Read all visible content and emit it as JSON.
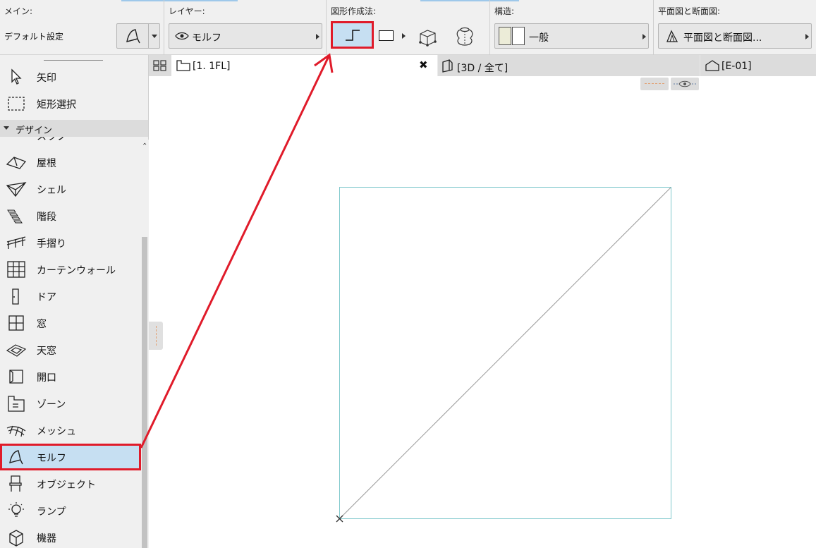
{
  "infobox": {
    "main": {
      "title": "メイン:",
      "default_label": "デフォルト設定"
    },
    "layer": {
      "title": "レイヤー:",
      "value": "モルフ"
    },
    "geometry": {
      "title": "図形作成法:"
    },
    "structure": {
      "title": "構造:",
      "value": "一般"
    },
    "plan_section": {
      "title": "平面図と断面図:",
      "value": "平面図と断面図..."
    }
  },
  "sidebar": {
    "top_items": [
      {
        "label": "矢印",
        "icon": "arrow-cursor-icon"
      },
      {
        "label": "矩形選択",
        "icon": "marquee-icon"
      }
    ],
    "section_header": "デザイン",
    "partial_item": "スラブ",
    "items": [
      {
        "label": "屋根",
        "icon": "roof-icon"
      },
      {
        "label": "シェル",
        "icon": "shell-icon"
      },
      {
        "label": "階段",
        "icon": "stair-icon"
      },
      {
        "label": "手摺り",
        "icon": "railing-icon"
      },
      {
        "label": "カーテンウォール",
        "icon": "curtain-wall-icon"
      },
      {
        "label": "ドア",
        "icon": "door-icon"
      },
      {
        "label": "窓",
        "icon": "window-icon"
      },
      {
        "label": "天窓",
        "icon": "skylight-icon"
      },
      {
        "label": "開口",
        "icon": "opening-icon"
      },
      {
        "label": "ゾーン",
        "icon": "zone-icon"
      },
      {
        "label": "メッシュ",
        "icon": "mesh-icon"
      },
      {
        "label": "モルフ",
        "icon": "morph-icon",
        "selected": true
      },
      {
        "label": "オブジェクト",
        "icon": "object-icon"
      },
      {
        "label": "ランプ",
        "icon": "lamp-icon"
      },
      {
        "label": "機器",
        "icon": "equipment-icon"
      }
    ]
  },
  "tabs": [
    {
      "label": "[1. 1FL]",
      "icon": "floor-plan-icon",
      "active": true
    },
    {
      "label": "[3D / 全て]",
      "icon": "3d-view-icon",
      "active": false
    },
    {
      "label": "[E-01]",
      "icon": "elevation-icon",
      "active": false
    }
  ],
  "colors": {
    "highlight": "#e01b2a",
    "selected_bg": "#c6dff2",
    "morph_outline": "#7fc8cc"
  }
}
